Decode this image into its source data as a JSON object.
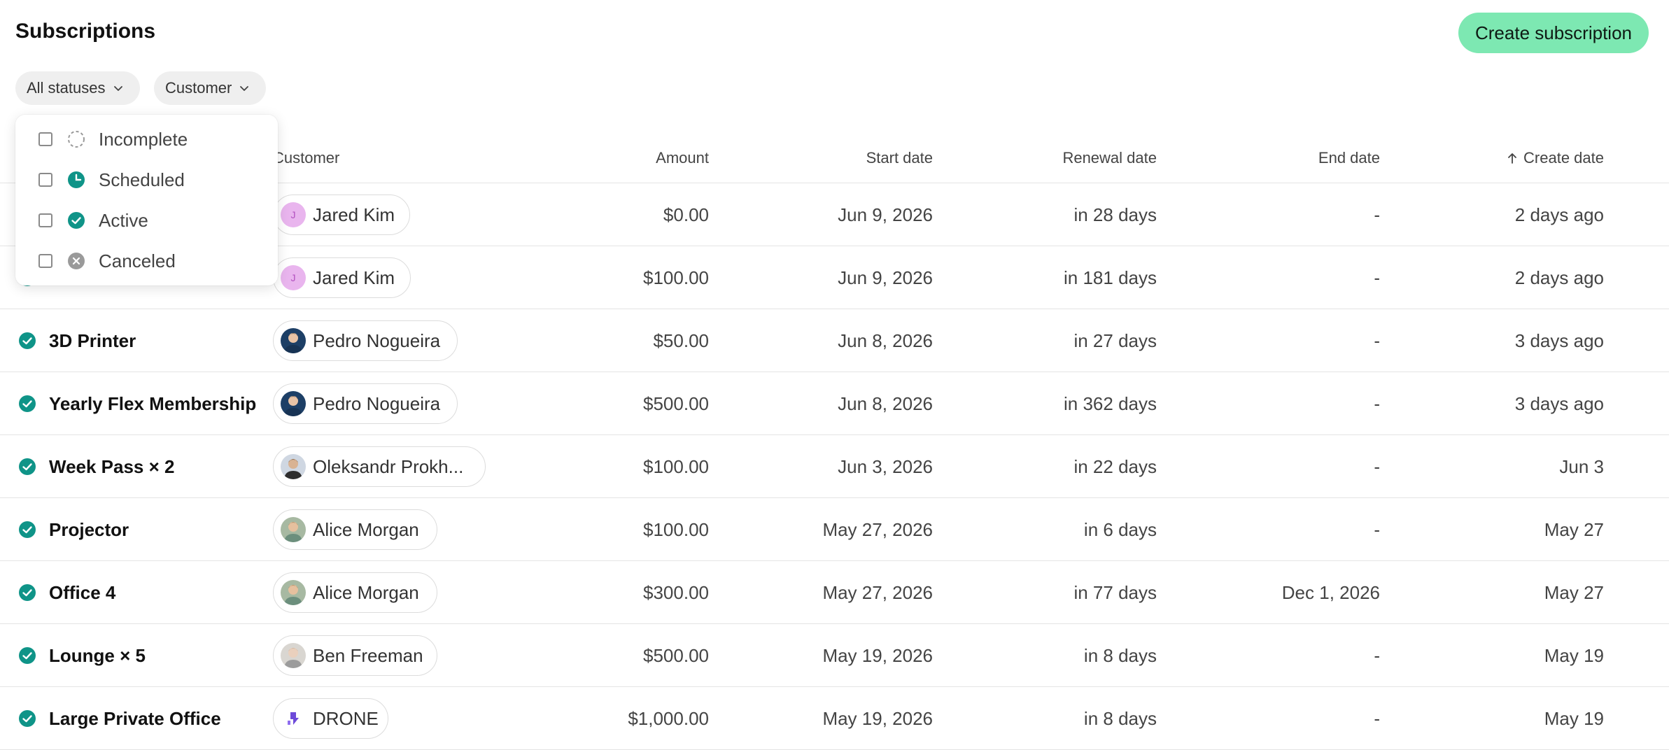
{
  "header": {
    "title": "Subscriptions",
    "create_label": "Create subscription"
  },
  "filters": {
    "status_label": "All statuses",
    "customer_label": "Customer"
  },
  "status_menu": {
    "options": [
      {
        "label": "Incomplete",
        "icon": "dashed-circle-icon"
      },
      {
        "label": "Scheduled",
        "icon": "clock-icon"
      },
      {
        "label": "Active",
        "icon": "check-circle-icon"
      },
      {
        "label": "Canceled",
        "icon": "x-circle-icon"
      }
    ]
  },
  "table": {
    "columns": {
      "customer": "Customer",
      "amount": "Amount",
      "start_date": "Start date",
      "renewal_date": "Renewal date",
      "end_date": "End date",
      "create_date": "Create date"
    },
    "rows": [
      {
        "name": "",
        "customer": "Jared Kim",
        "avatar_initial": "J",
        "amount": "$0.00",
        "start": "Jun 9, 2026",
        "renewal": "in 28 days",
        "end": "-",
        "created": "2 days ago"
      },
      {
        "name": "",
        "customer": "Jared Kim",
        "avatar_initial": "J",
        "amount": "$100.00",
        "start": "Jun 9, 2026",
        "renewal": "in 181 days",
        "end": "-",
        "created": "2 days ago"
      },
      {
        "name": "3D Printer",
        "customer": "Pedro Nogueira",
        "amount": "$50.00",
        "start": "Jun 8, 2026",
        "renewal": "in 27 days",
        "end": "-",
        "created": "3 days ago"
      },
      {
        "name": "Yearly Flex Membership",
        "customer": "Pedro Nogueira",
        "amount": "$500.00",
        "start": "Jun 8, 2026",
        "renewal": "in 362 days",
        "end": "-",
        "created": "3 days ago"
      },
      {
        "name": "Week Pass × 2",
        "customer": "Oleksandr Prokh...",
        "amount": "$100.00",
        "start": "Jun 3, 2026",
        "renewal": "in 22 days",
        "end": "-",
        "created": "Jun 3"
      },
      {
        "name": "Projector",
        "customer": "Alice Morgan",
        "amount": "$100.00",
        "start": "May 27, 2026",
        "renewal": "in 6 days",
        "end": "-",
        "created": "May 27"
      },
      {
        "name": "Office 4",
        "customer": "Alice Morgan",
        "amount": "$300.00",
        "start": "May 27, 2026",
        "renewal": "in 77 days",
        "end": "Dec 1, 2026",
        "created": "May 27"
      },
      {
        "name": "Lounge × 5",
        "customer": "Ben Freeman",
        "amount": "$500.00",
        "start": "May 19, 2026",
        "renewal": "in 8 days",
        "end": "-",
        "created": "May 19"
      },
      {
        "name": "Large Private Office",
        "customer": "DRONE",
        "amount": "$1,000.00",
        "start": "May 19, 2026",
        "renewal": "in 8 days",
        "end": "-",
        "created": "May 19"
      }
    ]
  },
  "colors": {
    "accent": "#7de8b2",
    "active": "#0f9488",
    "canceled": "#9a9a9a"
  }
}
